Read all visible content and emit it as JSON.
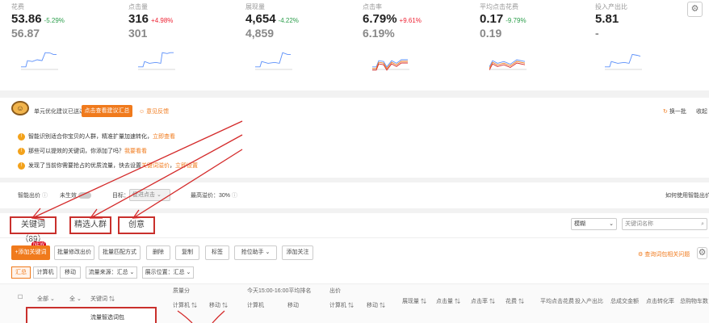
{
  "metrics": [
    {
      "label": "花费",
      "current": "53.86",
      "change": "-5.29%",
      "dir": "dn",
      "previous": "56.87"
    },
    {
      "label": "点击量",
      "current": "316",
      "change": "+4.98%",
      "dir": "up",
      "previous": "301"
    },
    {
      "label": "展现量",
      "current": "4,654",
      "change": "-4.22%",
      "dir": "dn",
      "previous": "4,859"
    },
    {
      "label": "点击率",
      "current": "6.79%",
      "change": "+9.61%",
      "dir": "up",
      "previous": "6.19%"
    },
    {
      "label": "平均点击花费",
      "current": "0.17",
      "change": "-9.79%",
      "dir": "dn",
      "previous": "0.19"
    },
    {
      "label": "投入产出比",
      "current": "5.81",
      "change": "",
      "dir": "up",
      "previous": "-"
    }
  ],
  "suggestion": {
    "head": "单元优化建议已送达",
    "button": "点击查看建议汇总",
    "feedback": "意见反馈",
    "refresh": "换一批",
    "collapse": "收起",
    "tips": [
      {
        "text": "智能识别适合你宝贝的人群，精准扩量加速转化，",
        "link": "立即查看"
      },
      {
        "text": "那些可以提效的关键词，你添加了吗？",
        "link": "我要看看"
      },
      {
        "text": "发现了当前你需要抢占的优质流量，快去设置",
        "link2": "关键词溢价",
        "link": "立即设置"
      }
    ]
  },
  "controls": {
    "smart_bid": "智能出价",
    "not_active": "未生效",
    "target_label": "目标：",
    "target_value": "促进点击",
    "premium_label": "最高溢价：",
    "premium_value": "30%",
    "how_link": "如何使用智能出价"
  },
  "tabs": [
    {
      "label": "关键词（89）"
    },
    {
      "label": "精选人群"
    },
    {
      "label": "创意"
    }
  ],
  "search": {
    "select": "模糊",
    "placeholder": "关键词名称"
  },
  "toolbar": {
    "new_badge": "NEW",
    "buttons": [
      "+添加关键词",
      "批量修改出价",
      "批量匹配方式",
      "删除",
      "复制",
      "标签",
      "抢位助手",
      "添加关注"
    ],
    "right_link": "查询词包相关问题"
  },
  "filters": {
    "segments": [
      "汇总",
      "计算机",
      "移动"
    ],
    "source": "流量来源：汇总",
    "position": "展示位置：汇总"
  },
  "table": {
    "all_label": "全部",
    "header_all2": "全",
    "kw_header": "关键词 ⇅",
    "quality": "质量分",
    "avg_rank": "今天15:00-16:00平均排名",
    "bid": "出价",
    "pc": "计算机 ⇅",
    "mobile": "移动 ⇅",
    "pc2": "计算机",
    "mobile2": "移动",
    "pc3": "计算机 ⇅",
    "mobile3": "移动 ⇅",
    "cols": [
      "展现量 ⇅",
      "点击量 ⇅",
      "点击率 ⇅",
      "花费 ⇅",
      "平均点击花费",
      "投入产出比",
      "总成交金额",
      "点击转化率",
      "总购物车数"
    ],
    "row_label": "流量智选词包"
  }
}
